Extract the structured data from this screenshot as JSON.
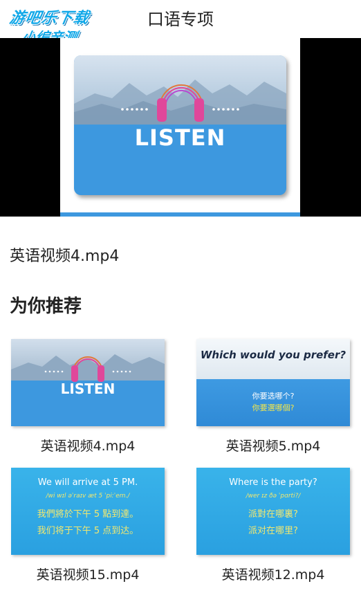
{
  "header": {
    "title": "口语专项",
    "back_icon": "back-arrow-icon"
  },
  "watermark": {
    "line1": "游吧乐下载",
    "line2": "小编亲测"
  },
  "player": {
    "card_text": "LISTEN",
    "icon": "headphones-icon"
  },
  "current": {
    "file_name": "英语视频4.mp4"
  },
  "recommend": {
    "heading": "为你推荐",
    "items": [
      {
        "caption": "英语视频4.mp4",
        "thumb_text": "LISTEN"
      },
      {
        "caption": "英语视频5.mp4",
        "question": "Which would you prefer?",
        "line1": "你要选哪个?",
        "line2": "你要選哪個?"
      },
      {
        "caption": "英语视频15.mp4",
        "en": "We will arrive at 5 PM.",
        "phonetic": "/wi wɪl əˈraɪv æt 5 ˈpiːˈem./",
        "zh1": "我們將於下午 5 點到達。",
        "zh2": "我们将于下午 5 点到达。"
      },
      {
        "caption": "英语视频12.mp4",
        "en": "Where is the party?",
        "phonetic": "/wer ɪz ðə ˈpɑrti?/",
        "zh1": "派對在哪裏?",
        "zh2": "派对在哪里?"
      }
    ]
  },
  "colors": {
    "accent_blue": "#3d98df",
    "sky": "#c9d9e8",
    "headphone_pink": "#e0479a"
  }
}
